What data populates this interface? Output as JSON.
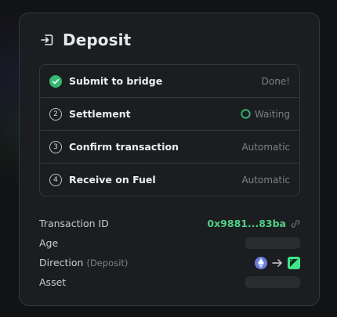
{
  "dialog": {
    "title": "Deposit",
    "icon": "deposit-arrow-icon"
  },
  "steps": [
    {
      "number": "",
      "label": "Submit to bridge",
      "status": "Done!",
      "state": "done",
      "icon": "check-circle-icon"
    },
    {
      "number": "2",
      "label": "Settlement",
      "status": "Waiting",
      "state": "waiting",
      "icon": "spinner-icon"
    },
    {
      "number": "3",
      "label": "Confirm transaction",
      "status": "Automatic",
      "state": "pending"
    },
    {
      "number": "4",
      "label": "Receive on Fuel",
      "status": "Automatic",
      "state": "pending"
    }
  ],
  "details": {
    "transaction_id": {
      "label": "Transaction ID",
      "value": "0x9881...83ba",
      "icon": "link-icon"
    },
    "age": {
      "label": "Age",
      "value": ""
    },
    "direction": {
      "label": "Direction",
      "sublabel": "(Deposit)",
      "from_icon": "ethereum-icon",
      "arrow_icon": "arrow-right-icon",
      "to_icon": "fuel-icon"
    },
    "asset": {
      "label": "Asset",
      "value": ""
    }
  },
  "colors": {
    "accent_green": "#4fd089",
    "success": "#34b872",
    "ethereum": "#6b7dde",
    "fuel": "#3ee58b"
  }
}
